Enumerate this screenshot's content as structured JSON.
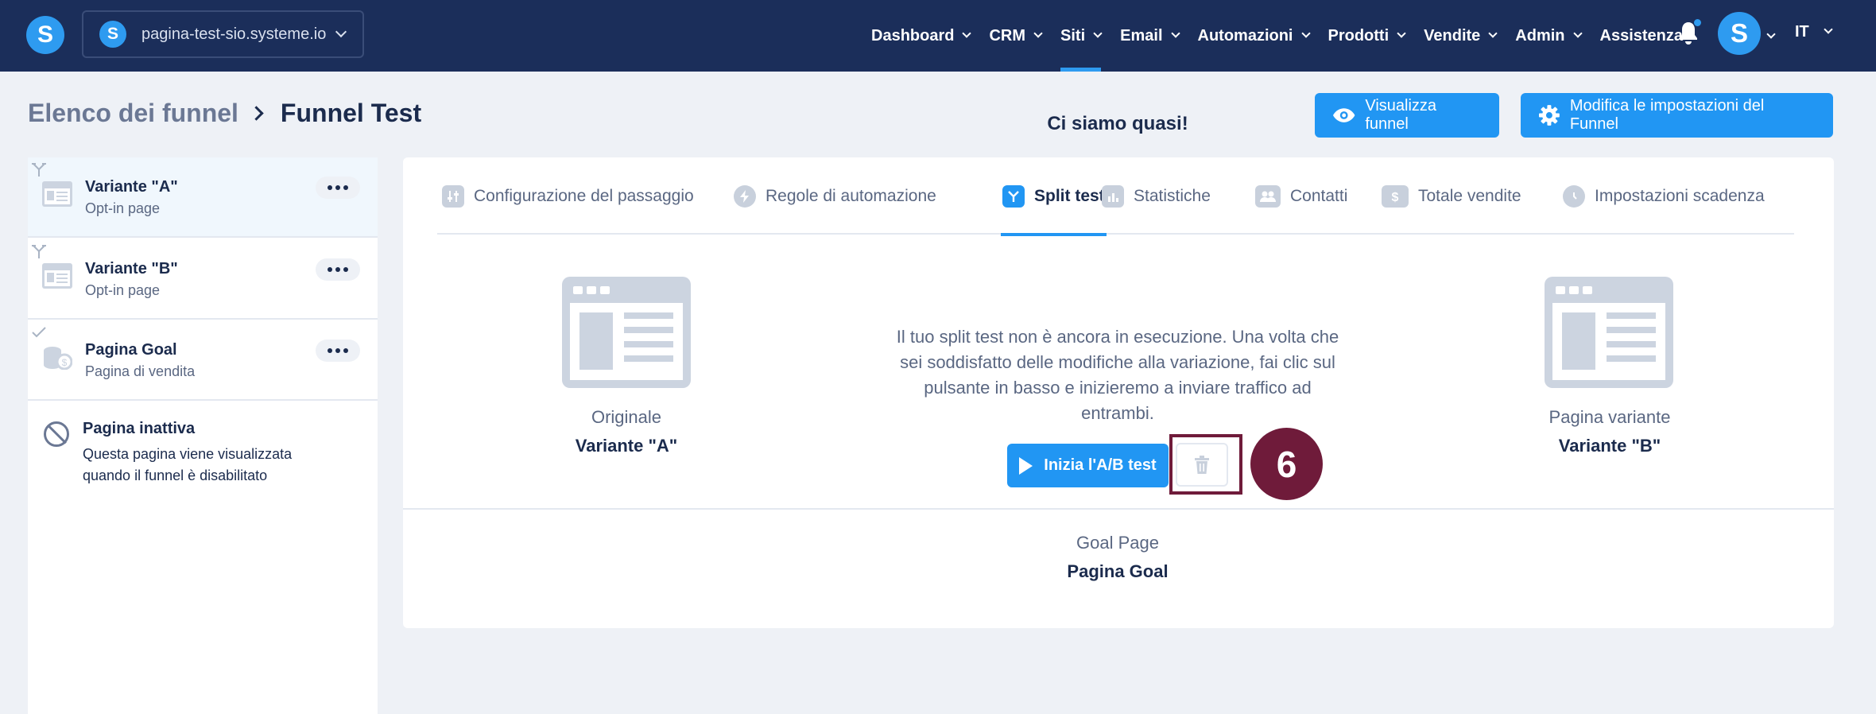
{
  "topbar": {
    "logo_letter": "S",
    "site_name": "pagina-test-sio.systeme.io",
    "nav": [
      {
        "label": "Dashboard"
      },
      {
        "label": "CRM"
      },
      {
        "label": "Siti"
      },
      {
        "label": "Email"
      },
      {
        "label": "Automazioni"
      },
      {
        "label": "Prodotti"
      },
      {
        "label": "Vendite"
      },
      {
        "label": "Admin"
      },
      {
        "label": "Assistenza"
      }
    ],
    "active_nav": "Siti",
    "avatar_letter": "S",
    "language": "IT",
    "icons": [
      "bell-icon",
      "chevron-down-icon"
    ]
  },
  "header": {
    "breadcrumb_root": "Elenco dei funnel",
    "breadcrumb_current": "Funnel Test",
    "view_button": "Visualizza funnel",
    "settings_button": "Modifica le impostazioni del Funnel"
  },
  "steps": [
    {
      "title": "Variante \"A\"",
      "subtitle": "Opt-in page"
    },
    {
      "title": "Variante \"B\"",
      "subtitle": "Opt-in page"
    },
    {
      "title": "Pagina Goal",
      "subtitle": "Pagina di vendita"
    }
  ],
  "inactive": {
    "title": "Pagina inattiva",
    "description": "Questa pagina viene visualizzata quando il funnel è disabilitato"
  },
  "tabs": [
    {
      "label": "Configurazione del passaggio",
      "icon": "sliders-icon"
    },
    {
      "label": "Regole di automazione",
      "icon": "bolt-icon"
    },
    {
      "label": "Split test",
      "icon": "split-icon"
    },
    {
      "label": "Statistiche",
      "icon": "chart-icon"
    },
    {
      "label": "Contatti",
      "icon": "contacts-icon"
    },
    {
      "label": "Totale vendite",
      "icon": "dollar-icon"
    },
    {
      "label": "Impostazioni scadenza",
      "icon": "clock-icon"
    }
  ],
  "active_tab": "Split test",
  "split": {
    "original_label": "Originale",
    "original_value": "Variante \"A\"",
    "variant_label": "Pagina variante",
    "variant_value": "Variante \"B\"",
    "title": "Ci siamo quasi!",
    "text": "Il tuo split test non è ancora in esecuzione. Una volta che sei soddisfatto delle modifiche alla variazione, fai clic sul pulsante in basso e inizieremo a inviare traffico ad entrambi.",
    "start_button": "Inizia l'A/B test",
    "step_number": "6",
    "goal_label": "Goal Page",
    "goal_value": "Pagina Goal"
  },
  "colors": {
    "topbar": "#1b2e5a",
    "accent": "#2196f3",
    "highlight": "#6f1b3a"
  }
}
